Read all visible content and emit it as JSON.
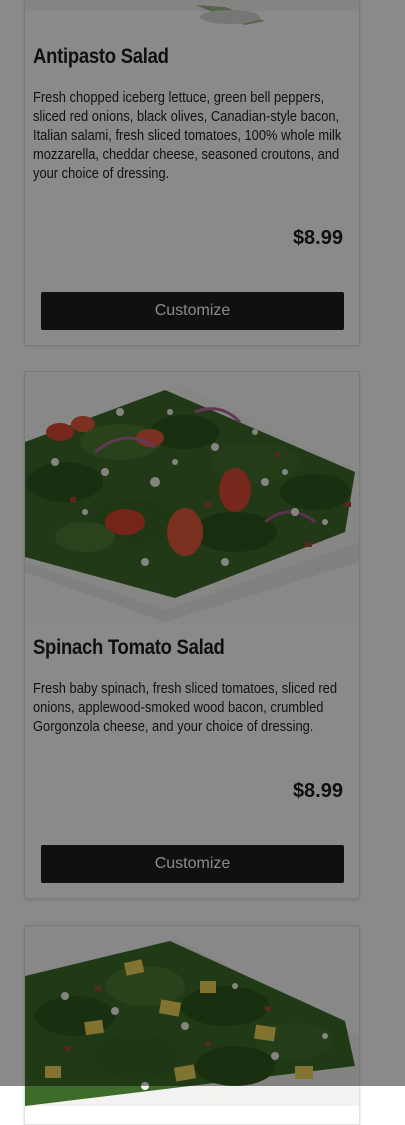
{
  "menu": {
    "items": [
      {
        "title": "Antipasto Salad",
        "description": "Fresh chopped iceberg lettuce, green bell peppers, sliced red onions, black olives, Canadian-style bacon, Italian salami, fresh sliced tomatoes, 100% whole milk mozzarella, cheddar cheese, seasoned croutons, and your choice of dressing.",
        "price": "$8.99",
        "button_label": "Customize"
      },
      {
        "title": "Spinach Tomato Salad",
        "description": "Fresh baby spinach, fresh sliced tomatoes, sliced red onions, applewood-smoked wood bacon, crumbled Gorgonzola cheese, and your choice of dressing.",
        "price": "$8.99",
        "button_label": "Customize"
      }
    ]
  },
  "colors": {
    "overlay": "rgba(0,0,0,0.46)",
    "button_bg": "#1e1e1e",
    "spinach": "#3d6b2a",
    "tomato": "#d8452e",
    "pineapple": "#f1d55a"
  }
}
